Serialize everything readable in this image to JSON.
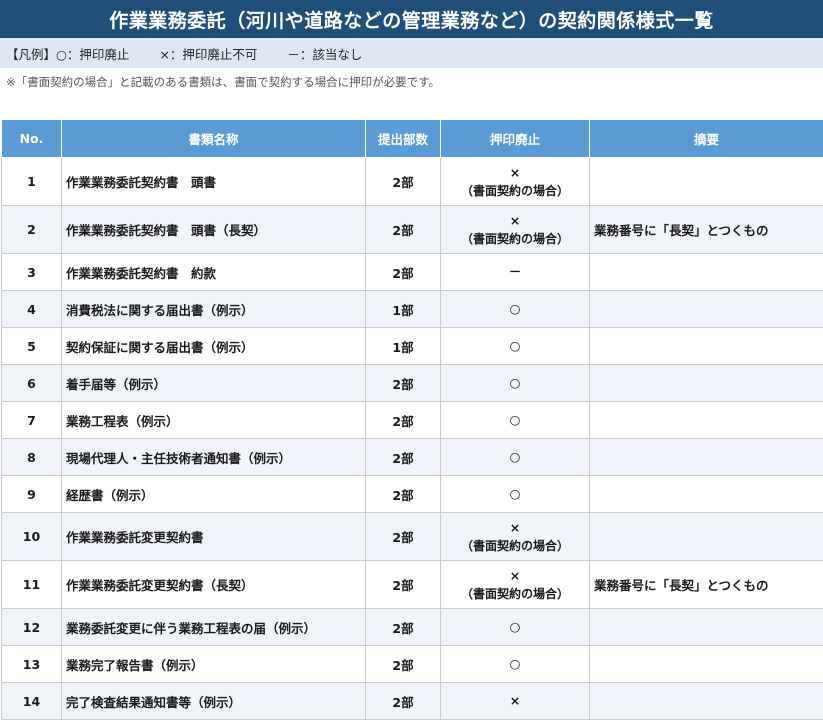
{
  "title": "作業業務委託（河川や道路などの管理業務など）の契約関係様式一覧",
  "legend": {
    "label": "【凡例】",
    "items": [
      "○：押印廃止",
      "×：押印廃止不可",
      "－：該当なし"
    ]
  },
  "note": "※「書面契約の場合」と記載のある書類は、書面で契約する場合に押印が必要です。",
  "table": {
    "headers": [
      "No.",
      "書類名称",
      "提出部数",
      "押印廃止",
      "摘要"
    ],
    "rows": [
      {
        "no": "1",
        "name": "作業業務委託契約書　頭書",
        "copies": "2部",
        "seal": "×",
        "seal_note": "（書面契約の場合）",
        "notes": ""
      },
      {
        "no": "2",
        "name": "作業業務委託契約書　頭書（長契）",
        "copies": "2部",
        "seal": "×",
        "seal_note": "（書面契約の場合）",
        "notes": "業務番号に「長契」とつくもの"
      },
      {
        "no": "3",
        "name": "作業業務委託契約書　約款",
        "copies": "2部",
        "seal": "－",
        "seal_note": "",
        "notes": ""
      },
      {
        "no": "4",
        "name": "消費税法に関する届出書（例示）",
        "copies": "1部",
        "seal": "○",
        "seal_note": "",
        "notes": ""
      },
      {
        "no": "5",
        "name": "契約保証に関する届出書（例示）",
        "copies": "1部",
        "seal": "○",
        "seal_note": "",
        "notes": ""
      },
      {
        "no": "6",
        "name": "着手届等（例示）",
        "copies": "2部",
        "seal": "○",
        "seal_note": "",
        "notes": ""
      },
      {
        "no": "7",
        "name": "業務工程表（例示）",
        "copies": "2部",
        "seal": "○",
        "seal_note": "",
        "notes": ""
      },
      {
        "no": "8",
        "name": "現場代理人・主任技術者通知書（例示）",
        "copies": "2部",
        "seal": "○",
        "seal_note": "",
        "notes": ""
      },
      {
        "no": "9",
        "name": "経歴書（例示）",
        "copies": "2部",
        "seal": "○",
        "seal_note": "",
        "notes": ""
      },
      {
        "no": "10",
        "name": "作業業務委託変更契約書",
        "copies": "2部",
        "seal": "×",
        "seal_note": "（書面契約の場合）",
        "notes": ""
      },
      {
        "no": "11",
        "name": "作業業務委託変更契約書（長契）",
        "copies": "2部",
        "seal": "×",
        "seal_note": "（書面契約の場合）",
        "notes": "業務番号に「長契」とつくもの"
      },
      {
        "no": "12",
        "name": "業務委託変更に伴う業務工程表の届（例示）",
        "copies": "2部",
        "seal": "○",
        "seal_note": "",
        "notes": ""
      },
      {
        "no": "13",
        "name": "業務完了報告書（例示）",
        "copies": "2部",
        "seal": "○",
        "seal_note": "",
        "notes": ""
      },
      {
        "no": "14",
        "name": "完了検査結果通知書等（例示）",
        "copies": "2部",
        "seal": "×",
        "seal_note": "",
        "notes": ""
      }
    ]
  },
  "colors": {
    "title_bg": "#1f4e79",
    "legend_bg": "#dde8f4",
    "header_bg": "#5b9bd5",
    "row_alt_bg": "#f0f4fa"
  }
}
